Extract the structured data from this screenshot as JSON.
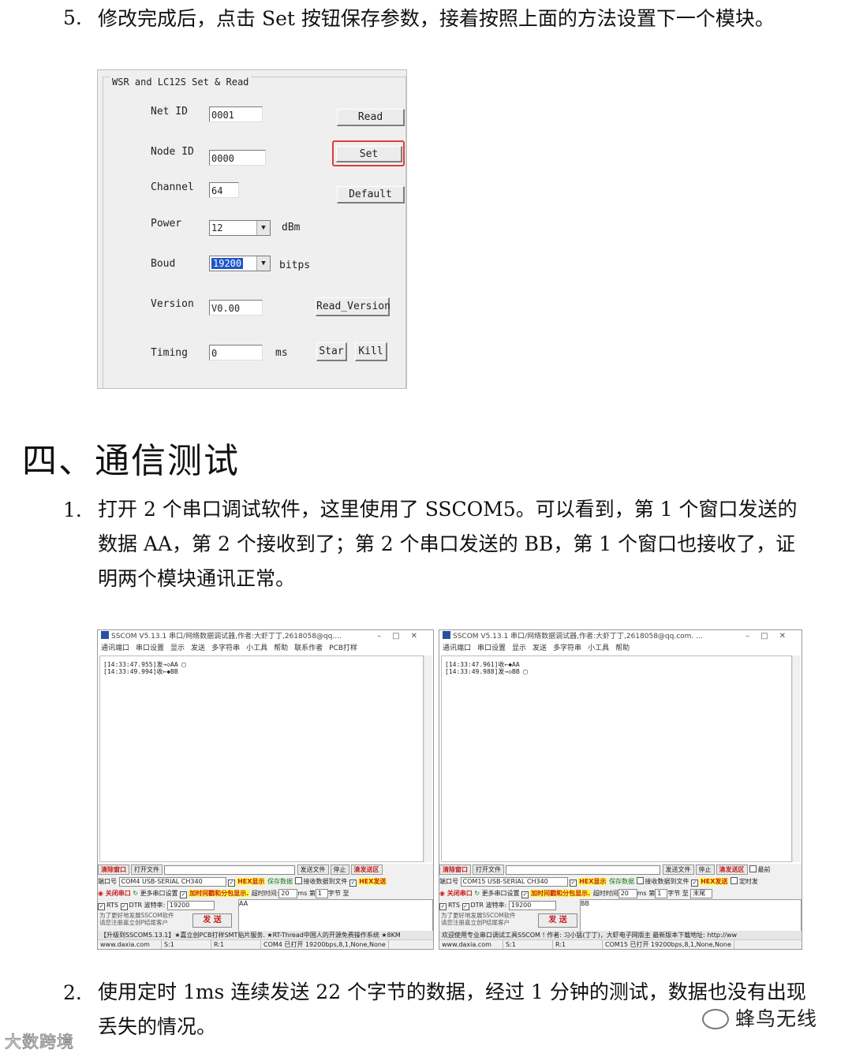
{
  "steps": {
    "step5_num": "5.",
    "step5_text": "修改完成后，点击 Set 按钮保存参数，接着按照上面的方法设置下一个模块。"
  },
  "dialog": {
    "group_title": "WSR and LC12S  Set & Read",
    "net_id_label": "Net ID",
    "net_id_value": "0001",
    "node_id_label": "Node ID",
    "node_id_value": "0000",
    "channel_label": "Channel",
    "channel_value": "64",
    "power_label": "Power",
    "power_value": "12",
    "power_unit": "dBm",
    "boud_label": "Boud",
    "boud_value": "19200",
    "boud_unit": "bitps",
    "version_label": "Version",
    "version_value": "V0.00",
    "timing_label": "Timing",
    "timing_value": "0",
    "timing_unit": "ms",
    "read_button": "Read",
    "set_button": "Set",
    "default_button": "Default",
    "read_version_button": "Read_Version",
    "star_button": "Star",
    "kill_button": "Kill"
  },
  "section": {
    "title": "四、通信测试"
  },
  "para1": {
    "num": "1.",
    "line1": "打开 2 个串口调试软件，这里使用了 SSCOM5。可以看到，第 1 个窗口发送的",
    "line2": "数据 AA，第 2 个接收到了；第 2 个串口发送的 BB，第 1 个窗口也接收了，证",
    "line3": "明两个模块通讯正常。"
  },
  "sscom_left": {
    "title": "SSCOM V5.13.1 串口/网络数据调试器,作者:大虾丁丁,2618058@qq....",
    "menu": [
      "通讯端口",
      "串口设置",
      "显示",
      "发送",
      "多字符串",
      "小工具",
      "帮助",
      "联系作者",
      "PCB打样"
    ],
    "rx_line1": "[14:33:47.955]发→◇AA □",
    "rx_line2": "[14:33:49.994]收←◆BB",
    "clear_window": "清除窗口",
    "open_file": "打开文件",
    "send_file": "发送文件",
    "stop": "停止",
    "clear_send": "清发送区",
    "port_label": "端口号",
    "port_value": "COM4 USB-SERIAL CH340",
    "hex_display": "HEX显示",
    "save_data": "保存数据",
    "recv_to_file": "接收数据到文件",
    "hex_send": "HEX发送",
    "close_port": "关闭串口",
    "more_settings": "更多串口设置",
    "timestamp": "加时间戳和分包显示.",
    "timeout_label": "超时时间:",
    "timeout_value": "20",
    "ms_label": "ms",
    "nth_label": "第",
    "nth_value": "1",
    "byte_label": "字节",
    "to_label": "至",
    "rts": "RTS",
    "dtr": "DTR",
    "baud_label": "波特率:",
    "baud_value": "19200",
    "tx_text": "AA",
    "hint1": "为了更好地发展SSCOM软件",
    "hint2": "请您注册嘉立创P结尾客户",
    "send": "发 送",
    "promo": "【升级到SSCOM5.13.1】★嘉立创PCB打样SMT贴片服务. ★RT-Thread中国人的开源免费操作系统 ★8KM",
    "status_site": "www.daxia.com",
    "status_s": "S:1",
    "status_r": "R:1",
    "status_port": "COM4 已打开  19200bps,8,1,None,None"
  },
  "sscom_right": {
    "title": "SSCOM V5.13.1 串口/网络数据调试器,作者:大虾丁丁,2618058@qq.com. ...",
    "menu": [
      "通讯端口",
      "串口设置",
      "显示",
      "发送",
      "多字符串",
      "小工具",
      "帮助"
    ],
    "rx_line1": "[14:33:47.961]收←◆AA",
    "rx_line2": "[14:33:49.988]发→◇BB □",
    "clear_window": "清除窗口",
    "open_file": "打开文件",
    "send_file": "发送文件",
    "stop": "停止",
    "clear_send": "清发送区",
    "top_last": "最前",
    "port_label": "端口号",
    "port_value": "COM15 USB-SERIAL CH340",
    "hex_display": "HEX显示",
    "save_data": "保存数据",
    "recv_to_file": "接收数据到文件",
    "hex_send": "HEX发送",
    "timed_send": "定时发",
    "close_port": "关闭串口",
    "more_settings": "更多串口设置",
    "timestamp": "加时间戳和分包显示.",
    "timeout_label": "超时时间",
    "timeout_value": "20",
    "ms_label": "ms",
    "nth_label": "第",
    "nth_value": "1",
    "byte_label": "字节",
    "to_label": "至",
    "end_label": "末尾",
    "rts": "RTS",
    "dtr": "DTR",
    "baud_label": "波特率:",
    "baud_value": "19200",
    "tx_text": "BB",
    "hint1": "为了更好地发展SSCOM软件",
    "hint2": "请您注册嘉立创P结尾客户",
    "send": "发 送",
    "promo": "欢迎使用专业串口调试工具SSCOM !  作者: 习小猛(丁丁)，大虾电子网版主  最新版本下载地址: http://ww",
    "status_site": "www.daxia.com",
    "status_s": "S:1",
    "status_r": "R:1",
    "status_port": "COM15 已打开  19200bps,8,1,None,None"
  },
  "para2": {
    "num": "2.",
    "line1": "使用定时 1ms 连续发送 22 个字节的数据，经过 1 分钟的测试，数据也没有出现",
    "line2": "丢失的情况。"
  },
  "watermarks": {
    "right": "蜂鸟无线",
    "left": "大数跨境"
  }
}
